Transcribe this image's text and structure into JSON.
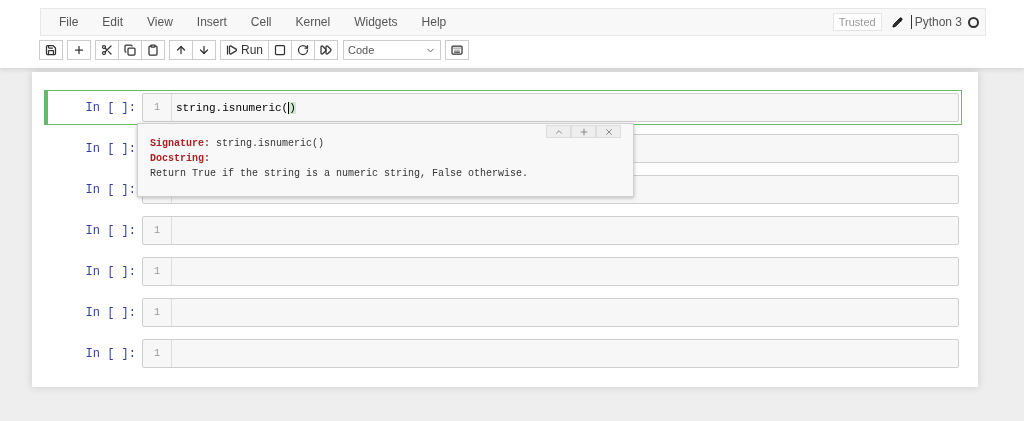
{
  "menu": [
    "File",
    "Edit",
    "View",
    "Insert",
    "Cell",
    "Kernel",
    "Widgets",
    "Help"
  ],
  "status": {
    "trusted": "Trusted",
    "kernel": "Python 3",
    "kernel_busy": false
  },
  "toolbar": {
    "run_label": "Run",
    "cell_type": "Code"
  },
  "cells": [
    {
      "prompt": "In [ ]:",
      "line_number": "1",
      "code": "string.isnumeric(",
      "code_bracket": ")",
      "selected": true
    },
    {
      "prompt": "In [ ]:",
      "selected": false
    },
    {
      "prompt": "In [ ]:",
      "selected": false
    },
    {
      "prompt": "In [ ]:",
      "line_number": "1",
      "selected": false
    },
    {
      "prompt": "In [ ]:",
      "line_number": "1",
      "selected": false
    },
    {
      "prompt": "In [ ]:",
      "line_number": "1",
      "selected": false
    },
    {
      "prompt": "In [ ]:",
      "line_number": "1",
      "selected": false
    }
  ],
  "tooltip": {
    "signature_label": "Signature:",
    "signature": "string.isnumeric()",
    "docstring_label": "Docstring:",
    "docstring": "Return True if the string is a numeric string, False otherwise."
  }
}
